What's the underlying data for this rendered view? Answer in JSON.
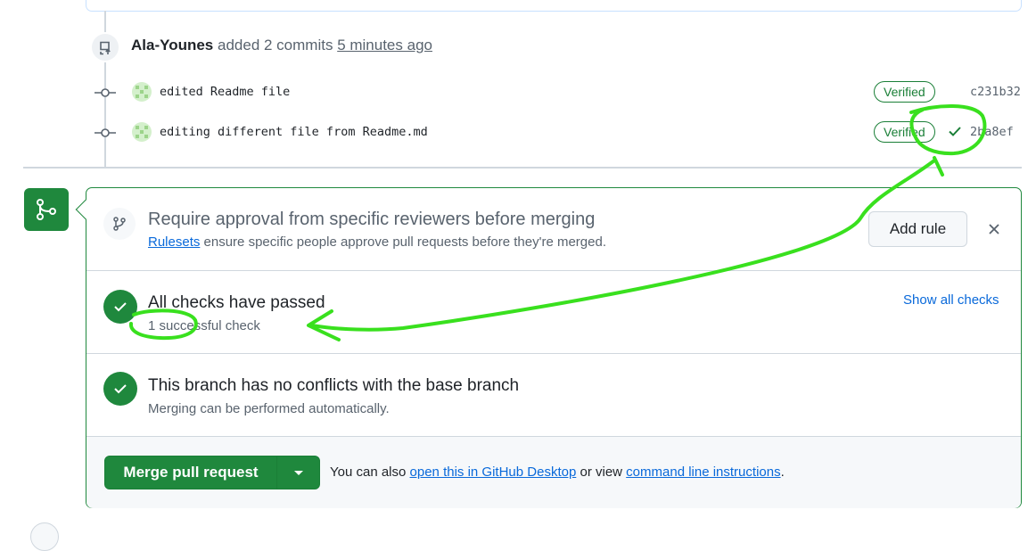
{
  "timeline": {
    "event": {
      "author": "Ala-Younes",
      "action": "added 2 commits",
      "time": "5 minutes ago"
    },
    "commits": [
      {
        "message": "edited Readme file",
        "badge": "Verified",
        "sha": "c231b32",
        "status_icon": ""
      },
      {
        "message": "editing different file from Readme.md",
        "badge": "Verified",
        "sha": "2ba8ef",
        "status_icon": "check-icon"
      }
    ]
  },
  "merge_box": {
    "ruleset": {
      "title": "Require approval from specific reviewers before merging",
      "link": "Rulesets",
      "subtitle_rest": "ensure specific people approve pull requests before they're merged.",
      "add_rule_label": "Add rule"
    },
    "checks": {
      "title": "All checks have passed",
      "subtitle": "1 successful check",
      "show_all_label": "Show all checks"
    },
    "conflicts": {
      "title": "This branch has no conflicts with the base branch",
      "subtitle": "Merging can be performed automatically."
    },
    "merge": {
      "button_label": "Merge pull request",
      "note_prefix": "You can also",
      "desktop_link": "open this in GitHub Desktop",
      "note_middle": "or view",
      "cli_link": "command line instructions",
      "note_suffix": "."
    }
  },
  "colors": {
    "success": "#1f883d",
    "link": "#0969da",
    "annotation": "#39e01e"
  }
}
